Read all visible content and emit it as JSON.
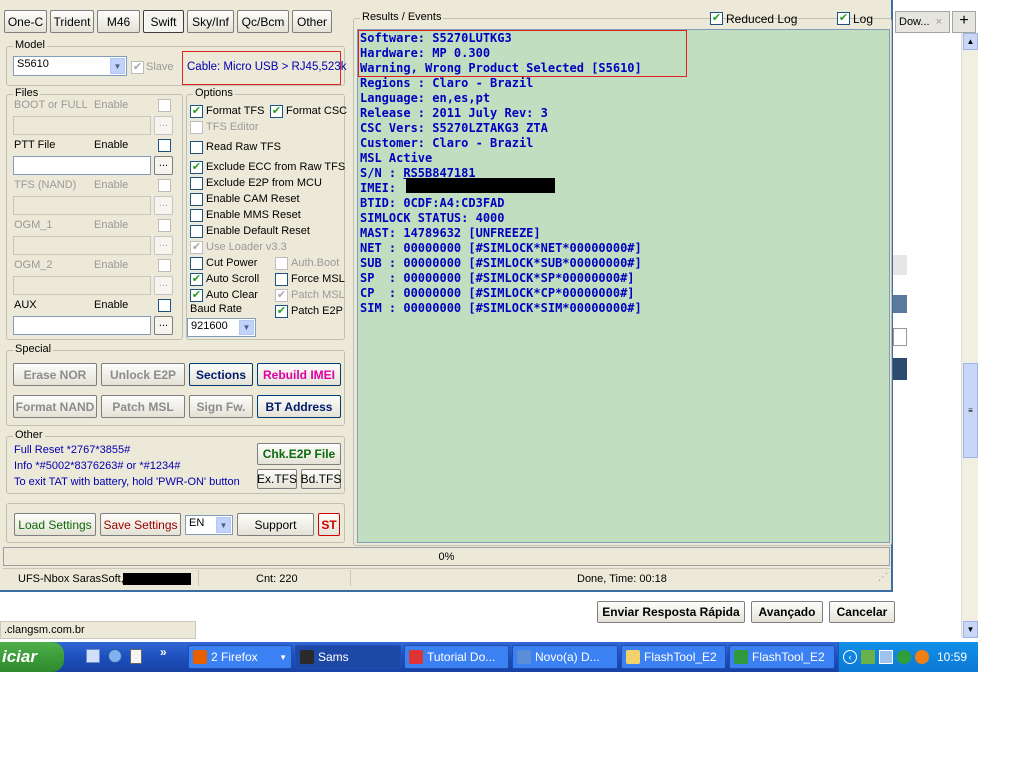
{
  "tabs": [
    "One-C",
    "Trident",
    "M46",
    "Swift",
    "Sky/Inf",
    "Qc/Bcm",
    "Other"
  ],
  "model": {
    "label": "Model",
    "value": "S5610",
    "slave_label": "Slave",
    "cable": "Cable: Micro USB > RJ45,523k"
  },
  "files": {
    "label": "Files",
    "rows": [
      {
        "name": "BOOT or FULL",
        "enable": "Enable"
      },
      {
        "name": "PTT File",
        "enable": "Enable"
      },
      {
        "name": "TFS (NAND)",
        "enable": "Enable"
      },
      {
        "name": "OGM_1",
        "enable": "Enable"
      },
      {
        "name": "OGM_2",
        "enable": "Enable"
      },
      {
        "name": "AUX",
        "enable": "Enable"
      }
    ],
    "browse": "..."
  },
  "options": {
    "label": "Options",
    "format_tfs": "Format TFS",
    "format_csc": "Format CSC",
    "tfs_editor": "TFS Editor",
    "read_raw_tfs": "Read Raw TFS",
    "exclude_ecc": "Exclude ECC from Raw TFS",
    "exclude_e2p": "Exclude E2P from MCU",
    "cam_reset": "Enable CAM Reset",
    "mms_reset": "Enable MMS Reset",
    "default_reset": "Enable Default Reset",
    "use_loader": "Use Loader v3.3",
    "cut_power": "Cut Power",
    "auth_boot": "Auth.Boot",
    "auto_scroll": "Auto Scroll",
    "force_msl": "Force MSL",
    "auto_clear": "Auto Clear",
    "patch_msl": "Patch MSL",
    "baud_label": "Baud Rate",
    "baud_value": "921600",
    "patch_e2p": "Patch E2P"
  },
  "special": {
    "label": "Special",
    "erase_nor": "Erase NOR",
    "unlock_e2p": "Unlock E2P",
    "sections": "Sections",
    "rebuild_imei": "Rebuild IMEI",
    "format_nand": "Format NAND",
    "patch_msl": "Patch MSL",
    "sign_fw": "Sign Fw.",
    "bt_address": "BT Address"
  },
  "other": {
    "label": "Other",
    "line1": "Full Reset  *2767*3855#",
    "line2": "Info  *#5002*8376263#  or *#1234#",
    "line3": "To exit TAT with battery, hold 'PWR-ON' button",
    "chk_e2p": "Chk.E2P File",
    "ex_tfs": "Ex.TFS",
    "bd_tfs": "Bd.TFS"
  },
  "bottom": {
    "load": "Load Settings",
    "save": "Save Settings",
    "lang": "EN",
    "support": "Support",
    "st": "ST"
  },
  "results": {
    "label": "Results / Events",
    "reduced_log": "Reduced Log",
    "log": "Log",
    "lines": [
      "Software: S5270LUTKG3",
      "Hardware: MP 0.300",
      "Warning, Wrong Product Selected [S5610]",
      "Regions : Claro - Brazil",
      "Language: en,es,pt",
      "Release : 2011 July Rev: 3",
      "CSC Vers: S5270LZTAKG3 ZTA",
      "Customer: Claro - Brazil",
      "MSL Active",
      "S/N : RS5B847181",
      "IMEI: ",
      "BTID: 0CDF:A4:CD3FAD",
      "SIMLOCK STATUS: 4000",
      "MAST: 14789632 [UNFREEZE]",
      "NET : 00000000 [#SIMLOCK*NET*00000000#]",
      "SUB : 00000000 [#SIMLOCK*SUB*00000000#]",
      "SP  : 00000000 [#SIMLOCK*SP*00000000#]",
      "CP  : 00000000 [#SIMLOCK*CP*00000000#]",
      "SIM : 00000000 [#SIMLOCK*SIM*00000000#]"
    ]
  },
  "progress": {
    "text": "0%",
    "fraction": 0
  },
  "status": {
    "app": "UFS-Nbox SarasSoft,",
    "cnt": "Cnt: 220",
    "done": "Done, Time: 00:18"
  },
  "browser": {
    "tab_title": "Dow...",
    "buttons": {
      "quick_reply": "Enviar Resposta Rápida",
      "advanced": "Avançado",
      "cancel": "Cancelar"
    },
    "status_url": ".clangsm.com.br"
  },
  "taskbar": {
    "start": "iciar",
    "items": [
      "2 Firefox",
      "Sams",
      "Tutorial Do...",
      "Novo(a) D...",
      "FlashTool_E2",
      "FlashTool_E2"
    ],
    "clock": "10:59"
  },
  "colors": {
    "log_bg": "#c1dfc0",
    "log_text": "#0000c0",
    "highlight_box": "#e32121",
    "rebuild_imei": "#e000a8",
    "start_green": "#3c9c3a"
  }
}
